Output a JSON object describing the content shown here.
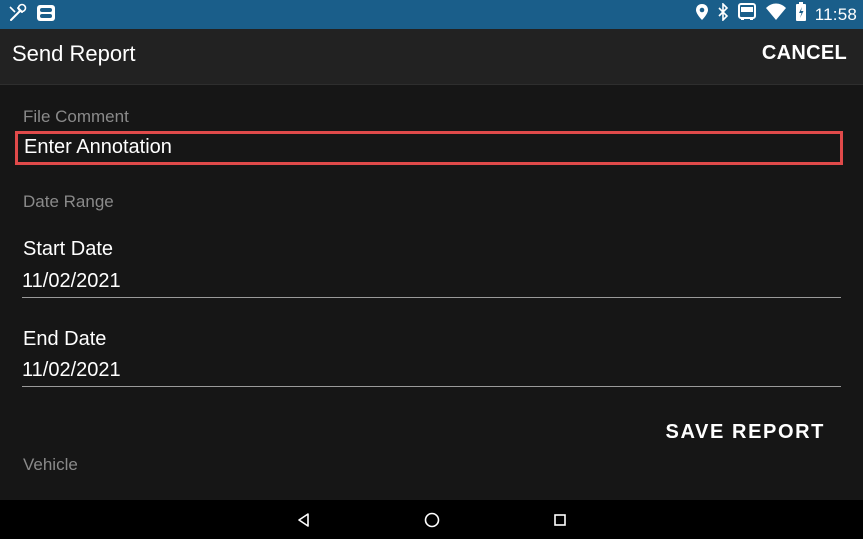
{
  "status_bar": {
    "time": "11:58",
    "icons": [
      "wrench-clock-icon",
      "message-icon",
      "location-pin-icon",
      "bluetooth-icon",
      "bus-icon",
      "wifi-icon",
      "battery-icon"
    ]
  },
  "toolbar": {
    "title": "Send Report",
    "cancel_label": "CANCEL"
  },
  "form": {
    "file_comment_label": "File Comment",
    "annotation_placeholder": "Enter Annotation",
    "date_range_label": "Date Range",
    "start_date_label": "Start Date",
    "start_date_value": "11/02/2021",
    "end_date_label": "End Date",
    "end_date_value": "11/02/2021",
    "save_report_label": "SAVE REPORT",
    "vehicle_label": "Vehicle"
  },
  "nav_bar": {
    "icons": [
      "back-icon",
      "home-icon",
      "recents-icon"
    ]
  },
  "colors": {
    "status_bar_bg": "#1a5e8a",
    "toolbar_bg": "#222222",
    "content_bg": "#161616",
    "highlight_border": "#e04a4a",
    "label_gray": "#8a8a8a"
  }
}
